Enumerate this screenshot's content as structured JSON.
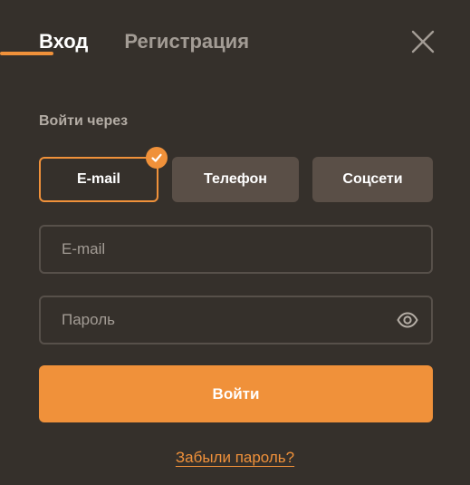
{
  "tabs": {
    "login": "Вход",
    "register": "Регистрация"
  },
  "section_label": "Войти через",
  "methods": {
    "email": "E-mail",
    "phone": "Телефон",
    "social": "Соцсети",
    "selected": "email"
  },
  "fields": {
    "email_placeholder": "E-mail",
    "password_placeholder": "Пароль"
  },
  "submit_label": "Войти",
  "forgot_label": "Забыли пароль?",
  "icons": {
    "close": "close-icon",
    "check": "check-icon",
    "eye": "eye-icon"
  },
  "colors": {
    "background": "#35302b",
    "accent": "#f0913a",
    "button_inactive": "#5a4f47",
    "field_border": "#57504a",
    "muted_text": "#a39c95"
  }
}
